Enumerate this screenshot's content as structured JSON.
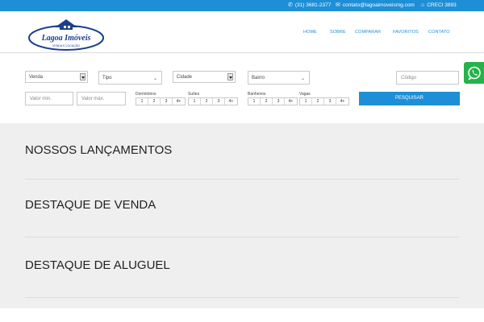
{
  "topbar": {
    "phone": "(31) 3681-2377",
    "email": "contato@lagoaimoveismg.com",
    "creci": "CRECI 3893",
    "icons": {
      "phone": "phone-icon",
      "email": "envelope-icon",
      "creci": "home-icon"
    }
  },
  "logo": {
    "name": "Lagoa Imóveis",
    "tagline": "VENDA E LOCAÇÃO"
  },
  "nav": [
    "HOME",
    "SOBRE",
    "COMPARAR",
    "FAVORITOS",
    "CONTATO"
  ],
  "search": {
    "venda": "Venda",
    "tipo": "Tipo",
    "cidade": "Cidade",
    "bairro": "Bairro",
    "codigo_placeholder": "Código",
    "valor_min_placeholder": "Valor mín.",
    "valor_max_placeholder": "Valor máx.",
    "dormitorios": "Dormitórios",
    "suites": "Suítes",
    "banheiros": "Banheiros",
    "vagas": "Vagas",
    "counts": [
      "1",
      "2",
      "3",
      "4+"
    ],
    "button": "PESQUISAR"
  },
  "sections": [
    "NOSSOS LANÇAMENTOS",
    "DESTAQUE DE VENDA",
    "DESTAQUE DE ALUGUEL"
  ],
  "colors": {
    "primary": "#1e8fd6",
    "whatsapp": "#25b34a",
    "content_bg": "#efefef"
  },
  "whatsapp_icon": "whatsapp-icon"
}
